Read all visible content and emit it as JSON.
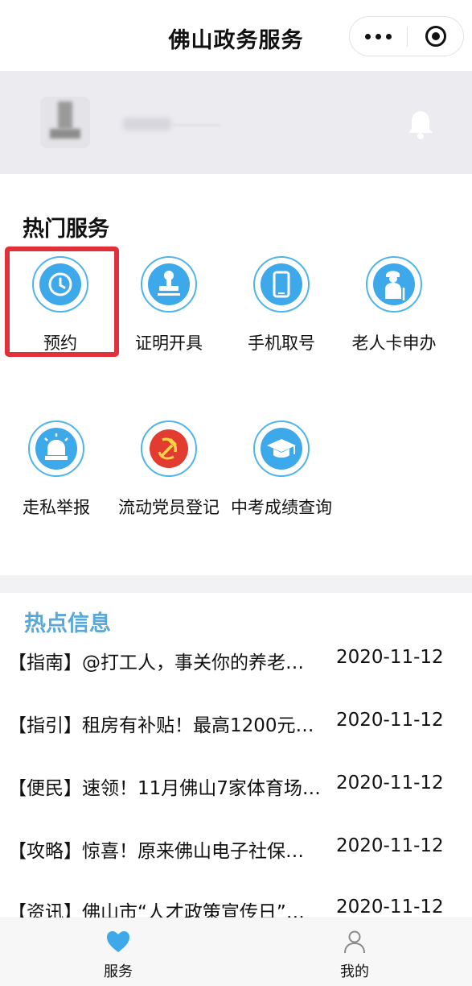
{
  "header": {
    "title": "佛山政务服务"
  },
  "hot_services": {
    "title": "热门服务",
    "items": [
      {
        "label": "预约",
        "icon": "clock-icon"
      },
      {
        "label": "证明开具",
        "icon": "stamp-icon"
      },
      {
        "label": "手机取号",
        "icon": "phone-icon"
      },
      {
        "label": "老人卡申办",
        "icon": "elderly-icon"
      },
      {
        "label": "走私举报",
        "icon": "alarm-light-icon"
      },
      {
        "label": "流动党员登记",
        "icon": "hammer-sickle-icon"
      },
      {
        "label": "中考成绩查询",
        "icon": "graduation-cap-icon"
      }
    ]
  },
  "news": {
    "title": "热点信息",
    "items": [
      {
        "headline": "【指南】@打工人，事关你的养老…",
        "date": "2020-11-12"
      },
      {
        "headline": "【指引】租房有补贴！最高1200元…",
        "date": "2020-11-12"
      },
      {
        "headline": "【便民】速领！11月佛山7家体育场…",
        "date": "2020-11-12"
      },
      {
        "headline": "【攻略】惊喜！原来佛山电子社保…",
        "date": "2020-11-12"
      },
      {
        "headline": "【资讯】佛山市“人才政策宣传日”…",
        "date": "2020-11-12"
      }
    ]
  },
  "tabbar": {
    "items": [
      {
        "label": "服务",
        "icon": "heart-icon"
      },
      {
        "label": "我的",
        "icon": "person-icon"
      }
    ]
  },
  "colors": {
    "accent": "#3ea9ea",
    "highlight": "#e2303a",
    "news_title": "#5aa8d8"
  }
}
